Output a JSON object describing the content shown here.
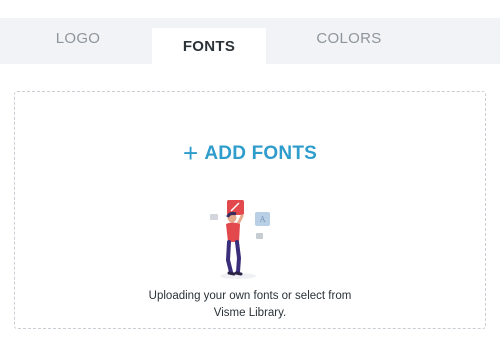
{
  "tabs": [
    {
      "label": "LOGO",
      "active": false
    },
    {
      "label": "FONTS",
      "active": true
    },
    {
      "label": "COLORS",
      "active": false
    }
  ],
  "dropzone": {
    "add_icon": "plus-icon",
    "add_label": "ADD FONTS",
    "caption_line1": "Uploading your own fonts or select from",
    "caption_line2": "Visme Library.",
    "illustration": "person-holding-font-cards-illustration"
  },
  "colors": {
    "accent": "#2f9dcc",
    "tab_bar_bg": "#f1f3f6",
    "active_tab_text": "#2b3238",
    "inactive_tab_text": "#8e959c",
    "dashed_border": "#c9ced4"
  }
}
